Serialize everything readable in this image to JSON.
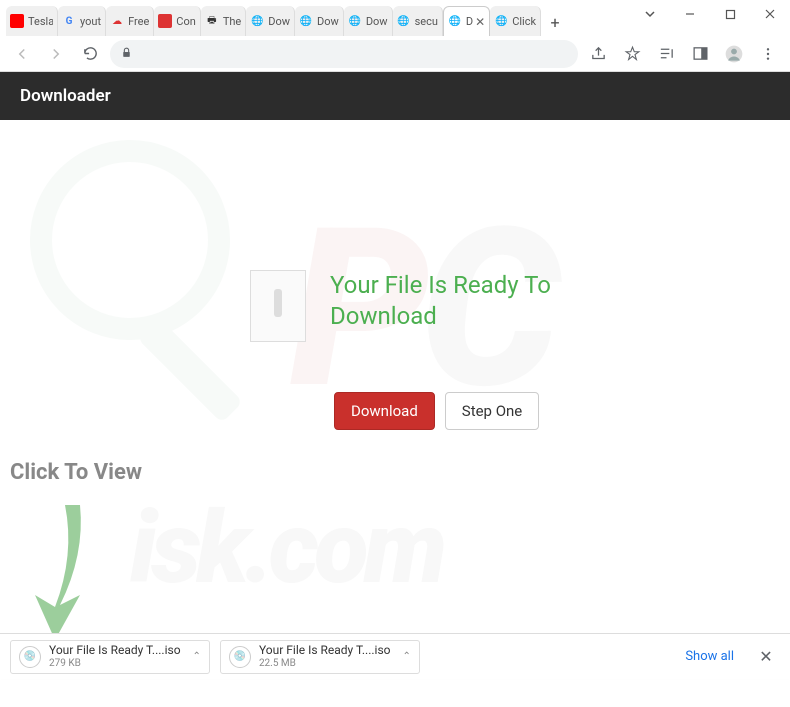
{
  "tabs": [
    {
      "label": "Tesla",
      "favicon_type": "yt"
    },
    {
      "label": "yout",
      "favicon_type": "g"
    },
    {
      "label": "Free",
      "favicon_type": "cloud"
    },
    {
      "label": "Con",
      "favicon_type": "red"
    },
    {
      "label": "The",
      "favicon_type": "printer"
    },
    {
      "label": "Dow",
      "favicon_type": "globe"
    },
    {
      "label": "Dow",
      "favicon_type": "globe"
    },
    {
      "label": "Dow",
      "favicon_type": "globe"
    },
    {
      "label": "secu",
      "favicon_type": "globe"
    },
    {
      "label": "D",
      "favicon_type": "globe",
      "active": true
    },
    {
      "label": "Click",
      "favicon_type": "globe"
    }
  ],
  "header": {
    "title": "Downloader"
  },
  "main": {
    "headline": "Your File Is Ready To Download",
    "download_btn": "Download",
    "step_btn": "Step One",
    "click_view": "Click To View"
  },
  "downloads": [
    {
      "name": "Your File Is Ready T....iso",
      "size": "279 KB"
    },
    {
      "name": "Your File Is Ready T....iso",
      "size": "22.5 MB"
    }
  ],
  "shelf": {
    "show_all": "Show all"
  },
  "omnibox": {
    "value": ""
  }
}
